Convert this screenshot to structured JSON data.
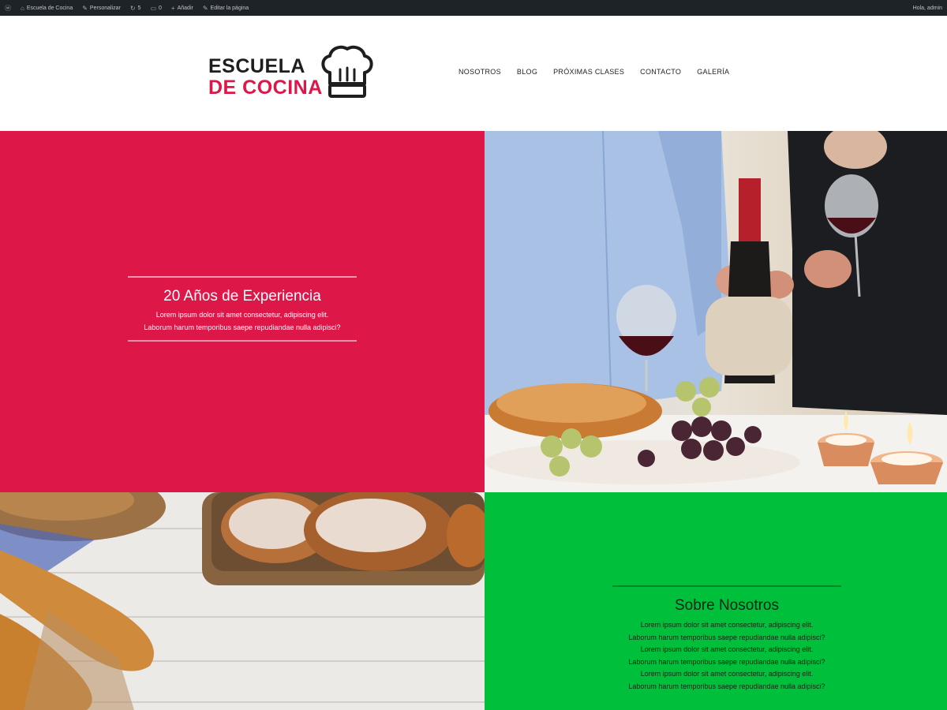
{
  "admin_bar": {
    "items": [
      "Escuela de Cocina",
      "Personalizar",
      "5",
      "0",
      "Añadir",
      "Editar la página"
    ],
    "user": "Hola, admin"
  },
  "logo": {
    "line1": "ESCUELA",
    "line2": "DE COCINA",
    "icon": "chef-hat-icon"
  },
  "nav": [
    "NOSOTROS",
    "BLOG",
    "PRÓXIMAS CLASES",
    "CONTACTO",
    "GALERÍA"
  ],
  "experience": {
    "title": "20 Años de Experiencia",
    "lines": [
      "Lorem ipsum dolor sit amet consectetur, adipiscing elit.",
      "Laborum harum temporibus saepe repudiandae nulla adipisci?"
    ]
  },
  "about": {
    "title": "Sobre Nosotros",
    "lines": [
      "Lorem ipsum dolor sit amet consectetur, adipiscing elit.",
      "Laborum harum temporibus saepe repudiandae nulla adipisci?",
      "Lorem ipsum dolor sit amet consectetur, adipiscing elit.",
      "Laborum harum temporibus saepe repudiandae nulla adipisci?",
      "Lorem ipsum dolor sit amet consectetur, adipiscing elit.",
      "Laborum harum temporibus saepe repudiandae nulla adipisci?"
    ]
  },
  "colors": {
    "accent_red": "#dd1748",
    "accent_green": "#00bf3a",
    "admin_bar": "#1d2327"
  }
}
